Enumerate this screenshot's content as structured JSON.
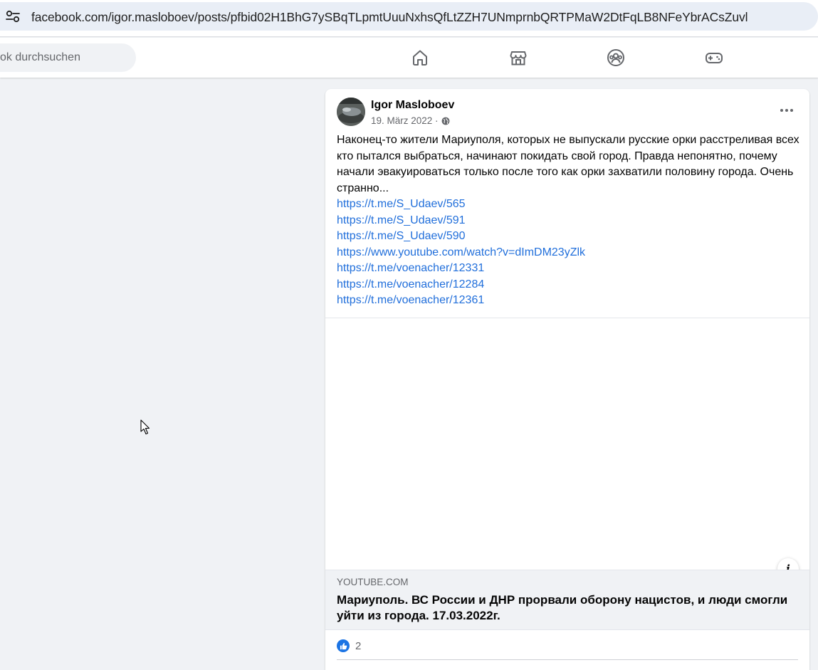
{
  "browser": {
    "url": "facebook.com/igor.masloboev/posts/pfbid02H1BhG7ySBqTLpmtUuuNxhsQfLtZZH7UNmprnbQRTPMaW2DtFqLB8NFeYbrACsZuvl",
    "site_info_icon": "tune-icon"
  },
  "nav": {
    "search_placeholder": "ok durchsuchen",
    "icons": [
      "home-icon",
      "marketplace-icon",
      "groups-icon",
      "gaming-icon"
    ]
  },
  "post": {
    "author": "Igor Masloboev",
    "date": "19. März 2022 ·",
    "privacy_icon": "globe-icon",
    "text": "Наконец-то жители Мариуполя, которых не выпускали русские орки расстреливая всех кто пытался выбраться, начинают покидать свой город. Правда непонятно, почему начали эвакуироваться только после того как орки захватили половину города. Очень странно...",
    "links": [
      "https://t.me/S_Udaev/565",
      "https://t.me/S_Udaev/591",
      "https://t.me/S_Udaev/590",
      "https://www.youtube.com/watch?v=dImDM23yZlk",
      "https://t.me/voenacher/12331",
      "https://t.me/voenacher/12284",
      "https://t.me/voenacher/12361"
    ],
    "preview": {
      "domain": "YOUTUBE.COM",
      "title": "Мариуполь. ВС России и ДНР прорвали оборону нацистов, и люди смогли уйти из города. 17.03.2022г.",
      "info_label": "i"
    },
    "reactions": {
      "like_count": "2",
      "accent": "#1b74e4"
    }
  }
}
